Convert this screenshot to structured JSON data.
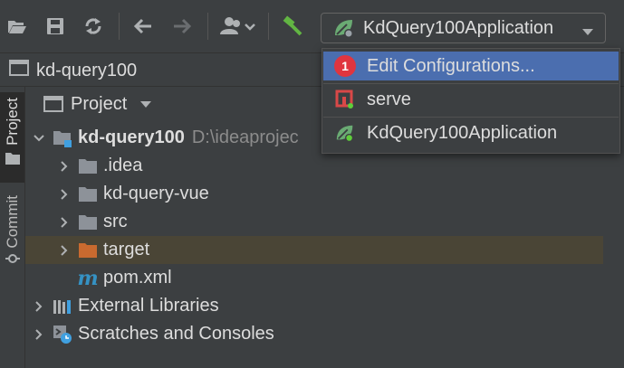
{
  "toolbar": {
    "buttons": [
      {
        "name": "open-icon"
      },
      {
        "name": "save-icon"
      },
      {
        "name": "sync-icon"
      },
      {
        "name": "back-icon"
      },
      {
        "name": "forward-icon"
      },
      {
        "name": "vcs-user-icon"
      },
      {
        "name": "build-hammer-icon"
      }
    ],
    "run_config_label": "KdQuery100Application"
  },
  "breadcrumb": {
    "label": "kd-query100"
  },
  "side_tabs": {
    "project": "Project",
    "commit": "Commit"
  },
  "project_panel": {
    "title": "Project",
    "tree": [
      {
        "label": "kd-query100",
        "path": "D:\\ideaprojec",
        "type": "module",
        "expanded": true
      },
      {
        "label": ".idea",
        "type": "folder"
      },
      {
        "label": "kd-query-vue",
        "type": "folder"
      },
      {
        "label": "src",
        "type": "folder"
      },
      {
        "label": "target",
        "type": "folder-excluded",
        "selected": true
      },
      {
        "label": "pom.xml",
        "type": "maven"
      },
      {
        "label": "External Libraries",
        "type": "libraries"
      },
      {
        "label": "Scratches and Consoles",
        "type": "scratches"
      }
    ]
  },
  "dropdown": {
    "items": [
      {
        "label": "Edit Configurations...",
        "badge": "1"
      },
      {
        "label": "serve"
      },
      {
        "label": "KdQuery100Application"
      }
    ]
  },
  "colors": {
    "background": "#3c3f41",
    "highlight": "#4b6eaf",
    "selected_row": "#4a4536",
    "badge": "#e0353f",
    "folder": "#8d9299",
    "excluded_folder": "#c96a2f",
    "spring_green": "#6aab73"
  }
}
